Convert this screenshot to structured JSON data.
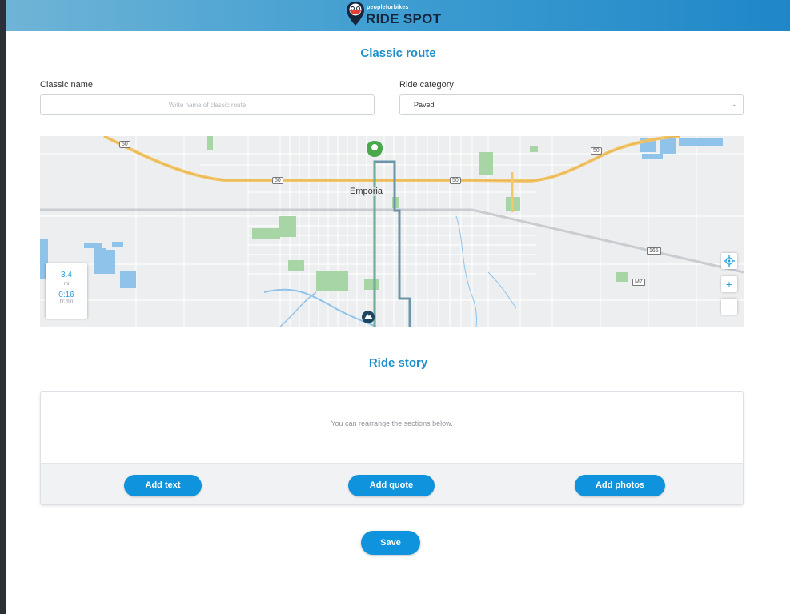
{
  "brand": {
    "tagline": "peopleforbikes",
    "name": "RIDE SPOT"
  },
  "classic_route": {
    "title": "Classic route",
    "name_label": "Classic name",
    "name_placeholder": "Write name of classic route",
    "name_value": "",
    "category_label": "Ride category",
    "category_value": "Paved"
  },
  "map": {
    "city_label": "Emporia",
    "highway_shields": [
      "50",
      "50",
      "50",
      "50"
    ],
    "route_shields": [
      "165",
      "M7"
    ],
    "distance": {
      "value": "3.4",
      "unit": "mi"
    },
    "time": {
      "value": "0:16",
      "unit": "hr:min"
    },
    "controls": {
      "zoom_in": "+",
      "zoom_out": "−"
    }
  },
  "ride_story": {
    "title": "Ride story",
    "hint": "You can rearrange the sections below.",
    "add_text": "Add text",
    "add_quote": "Add quote",
    "add_photos": "Add photos"
  },
  "save_label": "Save",
  "colors": {
    "accent": "#0e93dc",
    "header_start": "#6fb4d6",
    "header_end": "#1f87c8",
    "route": "#6c95a8"
  }
}
